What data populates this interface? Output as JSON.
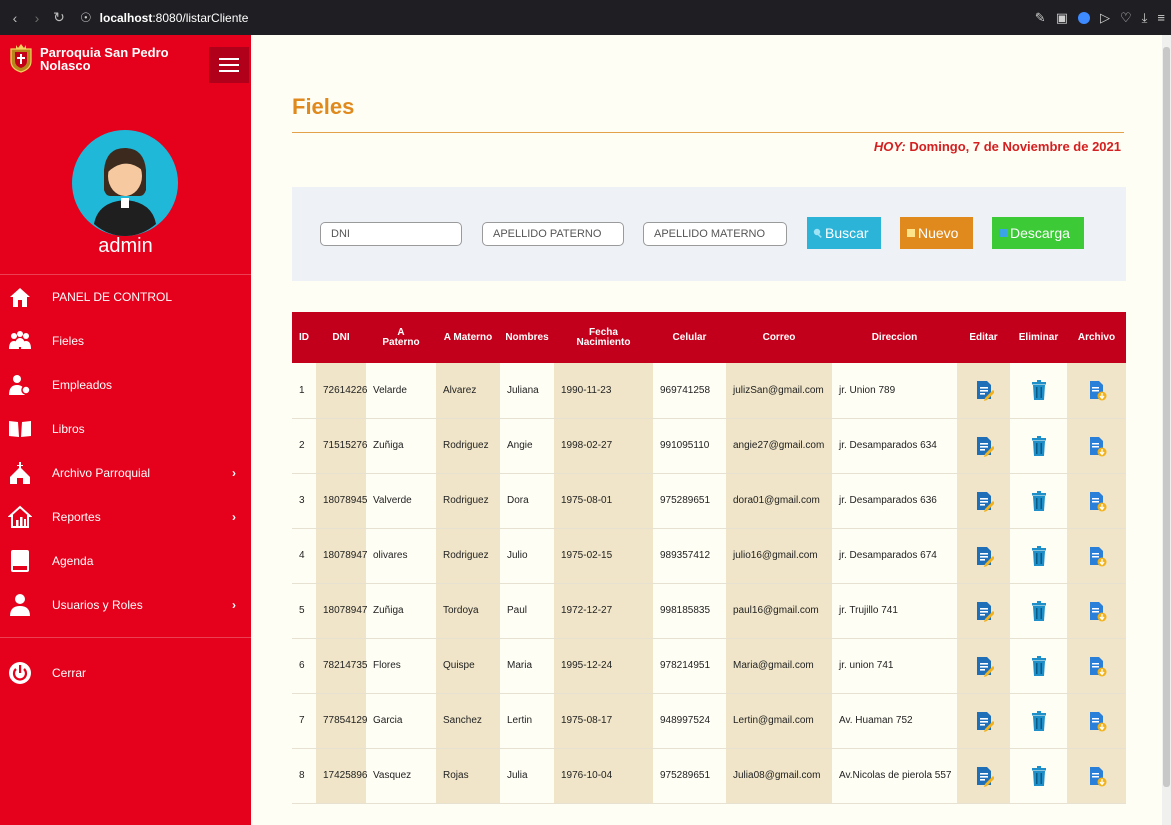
{
  "browser": {
    "url_host": "localhost",
    "url_path": ":8080/listarCliente"
  },
  "sidebar": {
    "brand_name": "Parroquia San Pedro Nolasco",
    "username": "admin",
    "items": [
      {
        "label": "PANEL DE CONTROL",
        "icon": "home-icon",
        "caret": ""
      },
      {
        "label": "Fieles",
        "icon": "group-icon",
        "caret": ""
      },
      {
        "label": "Empleados",
        "icon": "employee-icon",
        "caret": ""
      },
      {
        "label": "Libros",
        "icon": "book-icon",
        "caret": ""
      },
      {
        "label": "Archivo Parroquial",
        "icon": "church-icon",
        "caret": "›"
      },
      {
        "label": "Reportes",
        "icon": "chart-icon",
        "caret": "›"
      },
      {
        "label": "Agenda",
        "icon": "agenda-icon",
        "caret": ""
      },
      {
        "label": "Usuarios y Roles",
        "icon": "user-icon",
        "caret": "›"
      }
    ],
    "logout_label": "Cerrar"
  },
  "main": {
    "title": "Fieles",
    "today_label": "HOY:",
    "today_value": " Domingo, 7 de Noviembre de 2021",
    "filters": {
      "dni_placeholder": "DNI",
      "paterno_placeholder": "APELLIDO PATERNO",
      "materno_placeholder": "APELLIDO MATERNO",
      "search_label": "Buscar",
      "new_label": "Nuevo",
      "download_label": "Descarga"
    },
    "table": {
      "headers": [
        "ID",
        "DNI",
        "A Paterno",
        "A Materno",
        "Nombres",
        "Fecha Nacimiento",
        "Celular",
        "Correo",
        "Direccion",
        "Editar",
        "Eliminar",
        "Archivo"
      ],
      "rows": [
        [
          "1",
          "72614226",
          "Velarde",
          "Alvarez",
          "Juliana",
          "1990-11-23",
          "969741258",
          "julizSan@gmail.com",
          "jr. Union 789"
        ],
        [
          "2",
          "71515276",
          "Zuñiga",
          "Rodriguez",
          "Angie",
          "1998-02-27",
          "991095110",
          "angie27@gmail.com",
          "jr. Desamparados 634"
        ],
        [
          "3",
          "18078945",
          "Valverde",
          "Rodriguez",
          "Dora",
          "1975-08-01",
          "975289651",
          "dora01@gmail.com",
          "jr. Desamparados 636"
        ],
        [
          "4",
          "18078947",
          "olivares",
          "Rodriguez",
          "Julio",
          "1975-02-15",
          "989357412",
          "julio16@gmail.com",
          "jr. Desamparados 674"
        ],
        [
          "5",
          "18078947",
          "Zuñiga",
          "Tordoya",
          "Paul",
          "1972-12-27",
          "998185835",
          "paul16@gmail.com",
          "jr. Trujillo 741"
        ],
        [
          "6",
          "78214735",
          "Flores",
          "Quispe",
          "Maria",
          "1995-12-24",
          "978214951",
          "Maria@gmail.com",
          "jr. union 741"
        ],
        [
          "7",
          "77854129",
          "Garcia",
          "Sanchez",
          "Lertin",
          "1975-08-17",
          "948997524",
          "Lertin@gmail.com",
          "Av. Huaman 752"
        ],
        [
          "8",
          "17425896",
          "Vasquez",
          "Rojas",
          "Julia",
          "1976-10-04",
          "975289651",
          "Julia08@gmail.com",
          "Av.Nicolas de pierola 557"
        ]
      ]
    }
  },
  "colors": {
    "sidebar": "#e5001b",
    "title": "#e08a1e",
    "header": "#c3001c",
    "search_button": "#2bb3d8",
    "new_button": "#e08a1e",
    "download_button": "#3ccb37"
  }
}
